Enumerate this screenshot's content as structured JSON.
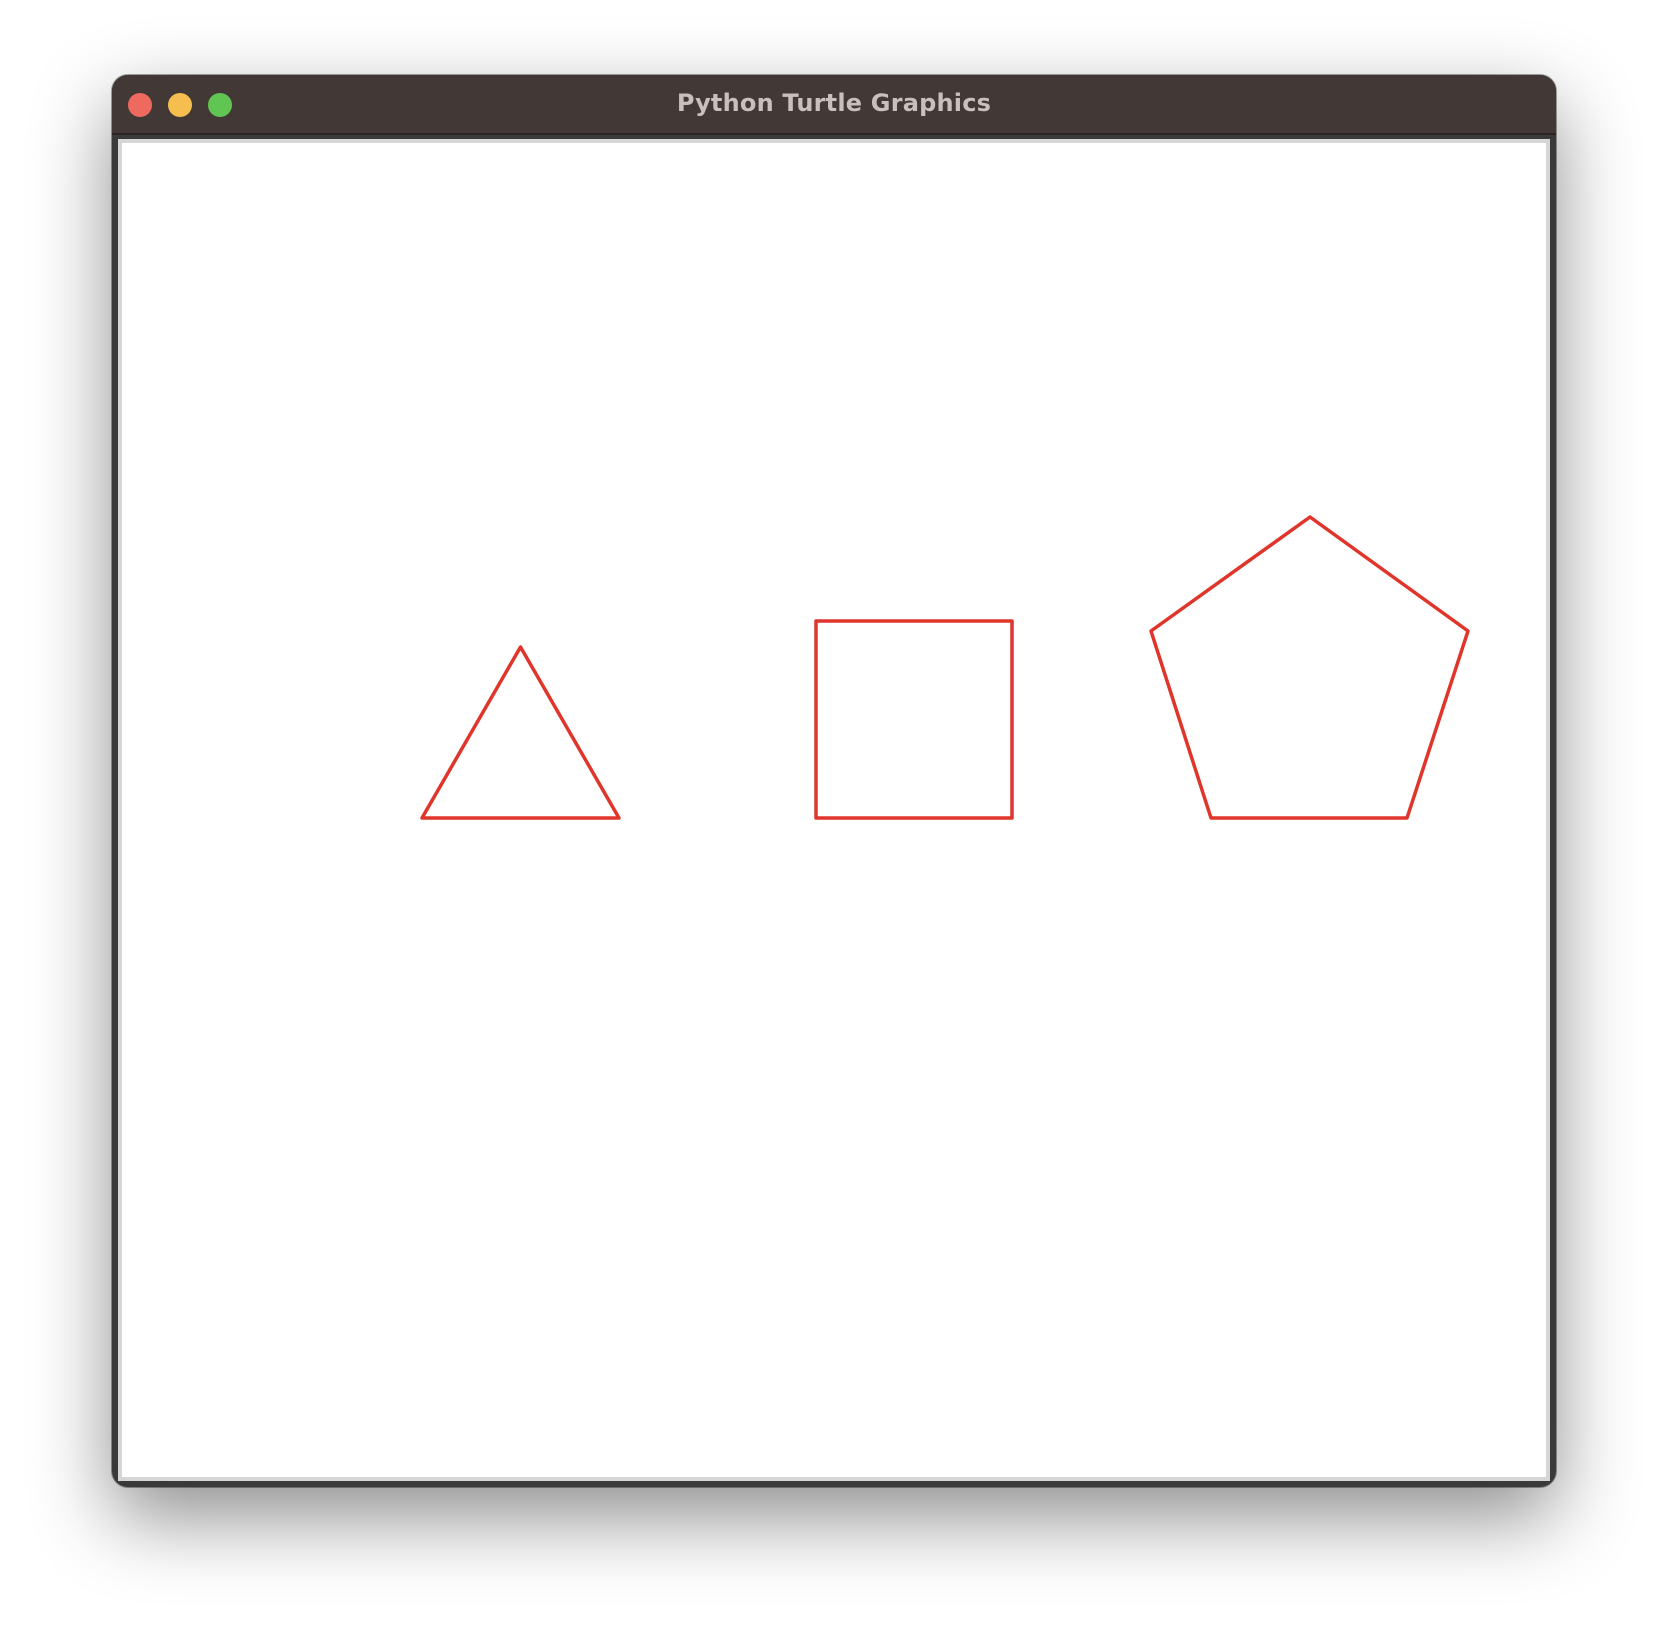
{
  "window": {
    "title": "Python Turtle Graphics"
  },
  "controls": {
    "close_icon": "close-icon",
    "minimize_icon": "minimize-icon",
    "zoom_icon": "zoom-icon",
    "close_color": "#ee6a5f",
    "minimize_color": "#f5be4f",
    "zoom_color": "#61c554"
  },
  "drawing": {
    "pen_color": "#e0352b",
    "background_color": "#ffffff",
    "shapes": [
      {
        "name": "triangle",
        "sides": 3
      },
      {
        "name": "square",
        "sides": 4
      },
      {
        "name": "pentagon",
        "sides": 5
      }
    ]
  }
}
